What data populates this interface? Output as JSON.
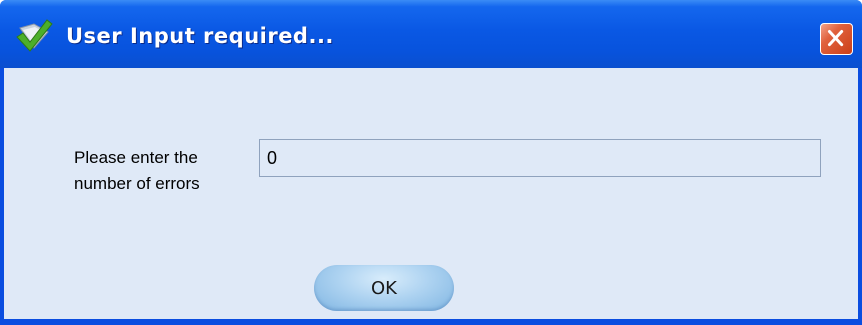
{
  "dialog": {
    "title": "User Input required...",
    "prompt": "Please enter the number of errors",
    "input_value": "0",
    "ok_label": "OK"
  },
  "icons": {
    "title_icon": "checkmark-icon",
    "close_icon": "close-icon"
  },
  "colors": {
    "titlebar": "#0853dd",
    "client_background": "#dfe9f7",
    "close_button": "#e0613c",
    "ok_button": "#aed3f1"
  }
}
